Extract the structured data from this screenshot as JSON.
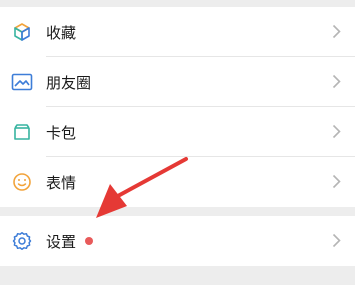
{
  "menu": {
    "items": [
      {
        "label": "收藏",
        "icon": "favorites-cube-icon"
      },
      {
        "label": "朋友圈",
        "icon": "moments-image-icon"
      },
      {
        "label": "卡包",
        "icon": "card-wallet-icon"
      },
      {
        "label": "表情",
        "icon": "sticker-smile-icon"
      }
    ],
    "settings": {
      "label": "设置",
      "icon": "gear-icon",
      "badge": "red-dot"
    }
  },
  "colors": {
    "page_bg": "#ededed",
    "row_bg": "#ffffff",
    "icon_blue": "#3d7dd8",
    "icon_orange": "#f2a33a",
    "icon_green": "#37b4a0",
    "badge_red": "#e85a5a",
    "annotation_arrow": "#e53935"
  }
}
